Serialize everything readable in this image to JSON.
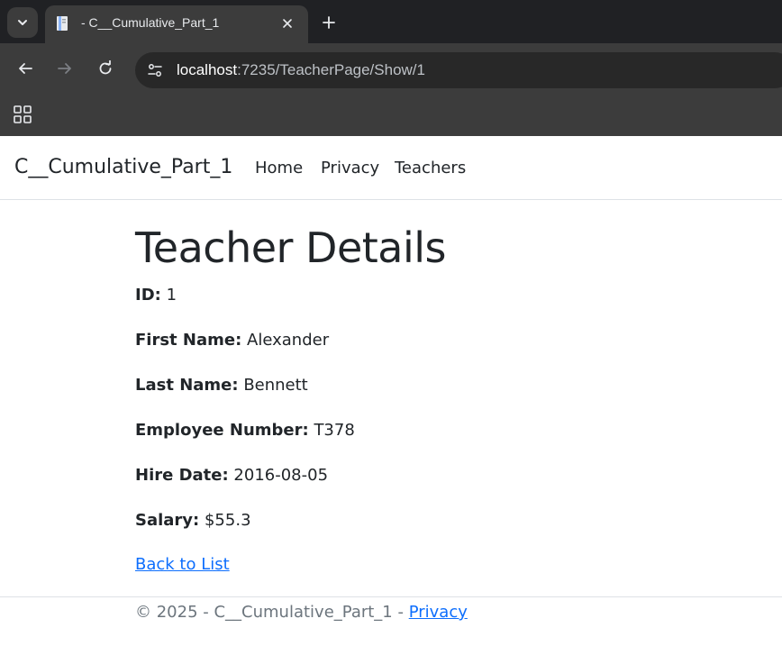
{
  "browser": {
    "tab": {
      "title": "- C__Cumulative_Part_1",
      "close_icon": "close-icon"
    },
    "address": {
      "host": "localhost",
      "path": ":7235/TeacherPage/Show/1"
    },
    "colors": {
      "frame": "#202124",
      "toolbar": "#3c3c3c",
      "omnibox": "#282828"
    }
  },
  "navbar": {
    "brand": "C__Cumulative_Part_1",
    "links": [
      "Home",
      "Privacy",
      "Teachers"
    ]
  },
  "teacher": {
    "heading": "Teacher Details",
    "fields": [
      {
        "label": "ID:",
        "value": "1"
      },
      {
        "label": "First Name:",
        "value": "Alexander"
      },
      {
        "label": "Last Name:",
        "value": "Bennett"
      },
      {
        "label": "Employee Number:",
        "value": "T378"
      },
      {
        "label": "Hire Date:",
        "value": "2016-08-05"
      },
      {
        "label": "Salary:",
        "value": "$55.3"
      }
    ],
    "back_link": "Back to List"
  },
  "footer": {
    "text": "© 2025 - C__Cumulative_Part_1 - ",
    "privacy_link": "Privacy"
  },
  "colors": {
    "link": "#0d6efd",
    "text": "#212529",
    "muted": "#6c757d"
  }
}
